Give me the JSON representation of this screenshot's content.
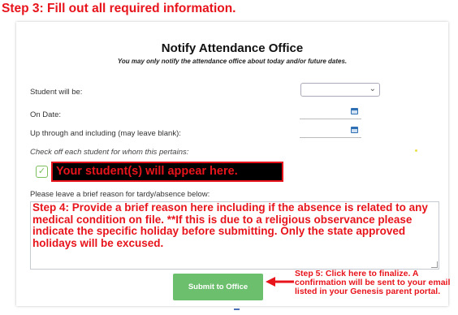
{
  "step3": "Step 3: Fill out all required information.",
  "form": {
    "title": "Notify Attendance Office",
    "subtitle": "You may only notify the attendance office about today and/or future dates.",
    "student_will_be_label": "Student will be:",
    "student_will_be_value": "",
    "on_date_label": "On Date:",
    "through_label": "Up through and including (may leave blank):",
    "check_off_label": "Check off each student for whom this pertains:",
    "student_placeholder": "Your student(s) will appear here.",
    "reason_label": "Please leave a brief reason for tardy/absence below:",
    "reason_text": "Step 4: Provide a brief reason here including if the absence is related to any medical condition on file. **If this is due to a religious observance please indicate the specific holiday before submitting. Only the state approved holidays will be excused.",
    "submit_label": "Submit to Office"
  },
  "step5": "Step 5: Click here to finalize. A confirmation will be sent to your email listed in your Genesis parent portal.",
  "colors": {
    "annotation_red": "#e8141c",
    "submit_green": "#6cbf6c",
    "calendar_blue": "#2f6fb3",
    "checkbox_green": "#7cbf5c"
  },
  "icons": [
    "calendar-icon",
    "chevron-down-icon",
    "check-icon",
    "arrow-left-icon"
  ]
}
